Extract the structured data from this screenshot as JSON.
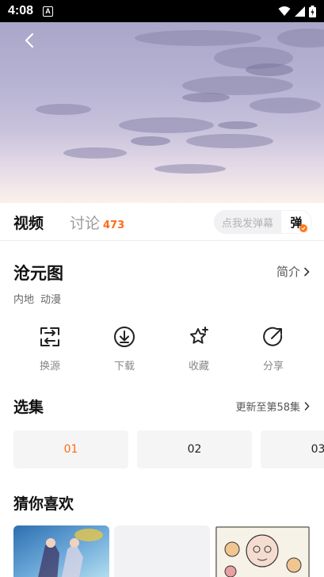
{
  "status": {
    "time": "4:08",
    "notif_letter": "A"
  },
  "tabs": {
    "video_label": "视频",
    "discuss_label": "讨论",
    "discuss_count": "473"
  },
  "danmu": {
    "placeholder": "点我发弹幕",
    "toggle_label": "弹"
  },
  "show": {
    "title": "沧元图",
    "intro_label": "简介",
    "tags": [
      "内地",
      "动漫"
    ]
  },
  "actions": [
    {
      "label": "换源",
      "icon": "switch-source-icon"
    },
    {
      "label": "下载",
      "icon": "download-icon"
    },
    {
      "label": "收藏",
      "icon": "star-icon"
    },
    {
      "label": "分享",
      "icon": "share-icon"
    }
  ],
  "episodes": {
    "title": "选集",
    "update_label": "更新至第58集",
    "items": [
      "01",
      "02",
      "03"
    ],
    "active_index": 0
  },
  "recommend": {
    "title": "猜你喜欢"
  },
  "colors": {
    "accent": "#ff6a1a",
    "bg_light": "#f5f5f5"
  }
}
